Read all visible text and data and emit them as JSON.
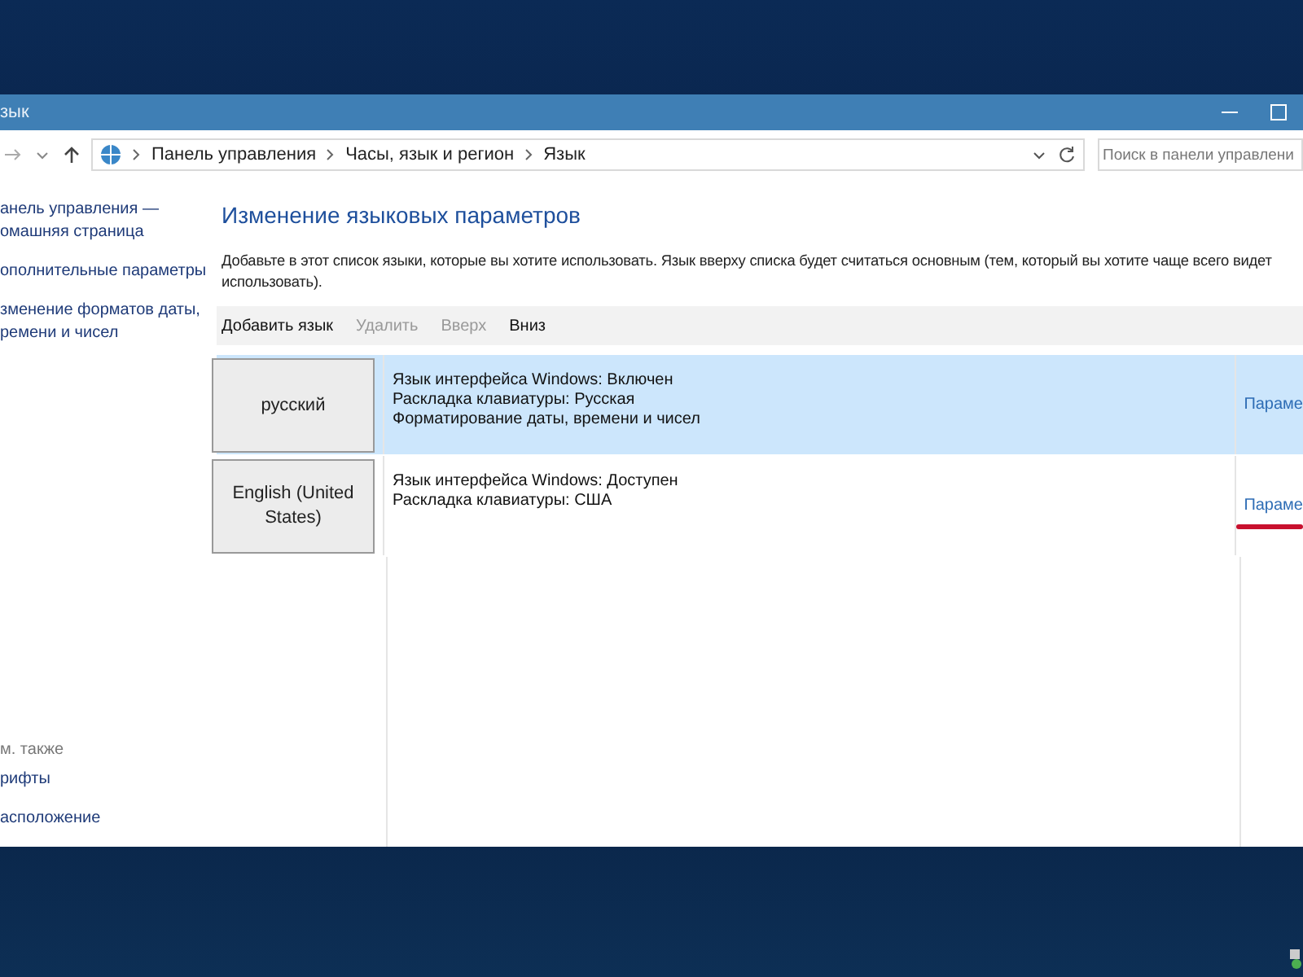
{
  "window": {
    "title": "зык"
  },
  "address_bar": {
    "breadcrumbs": [
      "Панель управления",
      "Часы, язык и регион",
      "Язык"
    ]
  },
  "search": {
    "placeholder": "Поиск в панели управлени"
  },
  "sidebar": {
    "links": [
      "анель управления —\nомашняя страница",
      "ополнительные параметры",
      "зменение форматов даты,\nремени и чисел"
    ],
    "see_also_title": "м. также",
    "see_also": [
      "рифты",
      "асположение"
    ]
  },
  "heading": "Изменение языковых параметров",
  "description": "Добавьте в этот список языки, которые вы хотите использовать. Язык вверху списка будет считаться основным (тем, который вы хотите чаще всего видет",
  "description_2": "использовать).",
  "toolbar": [
    {
      "label": "Добавить язык",
      "disabled": false
    },
    {
      "label": "Удалить",
      "disabled": true
    },
    {
      "label": "Вверх",
      "disabled": true
    },
    {
      "label": "Вниз",
      "disabled": false
    }
  ],
  "languages": [
    {
      "name": "русский",
      "selected": true,
      "details": [
        "Язык интерфейса Windows: Включен",
        "Раскладка клавиатуры: Русская",
        "Форматирование даты, времени и чисел"
      ],
      "options": "Параме",
      "underlined": false
    },
    {
      "name": "English (United\nStates)",
      "selected": false,
      "details": [
        "Язык интерфейса Windows: Доступен",
        "Раскладка клавиатуры: США"
      ],
      "options": "Параме",
      "underlined": true
    }
  ]
}
